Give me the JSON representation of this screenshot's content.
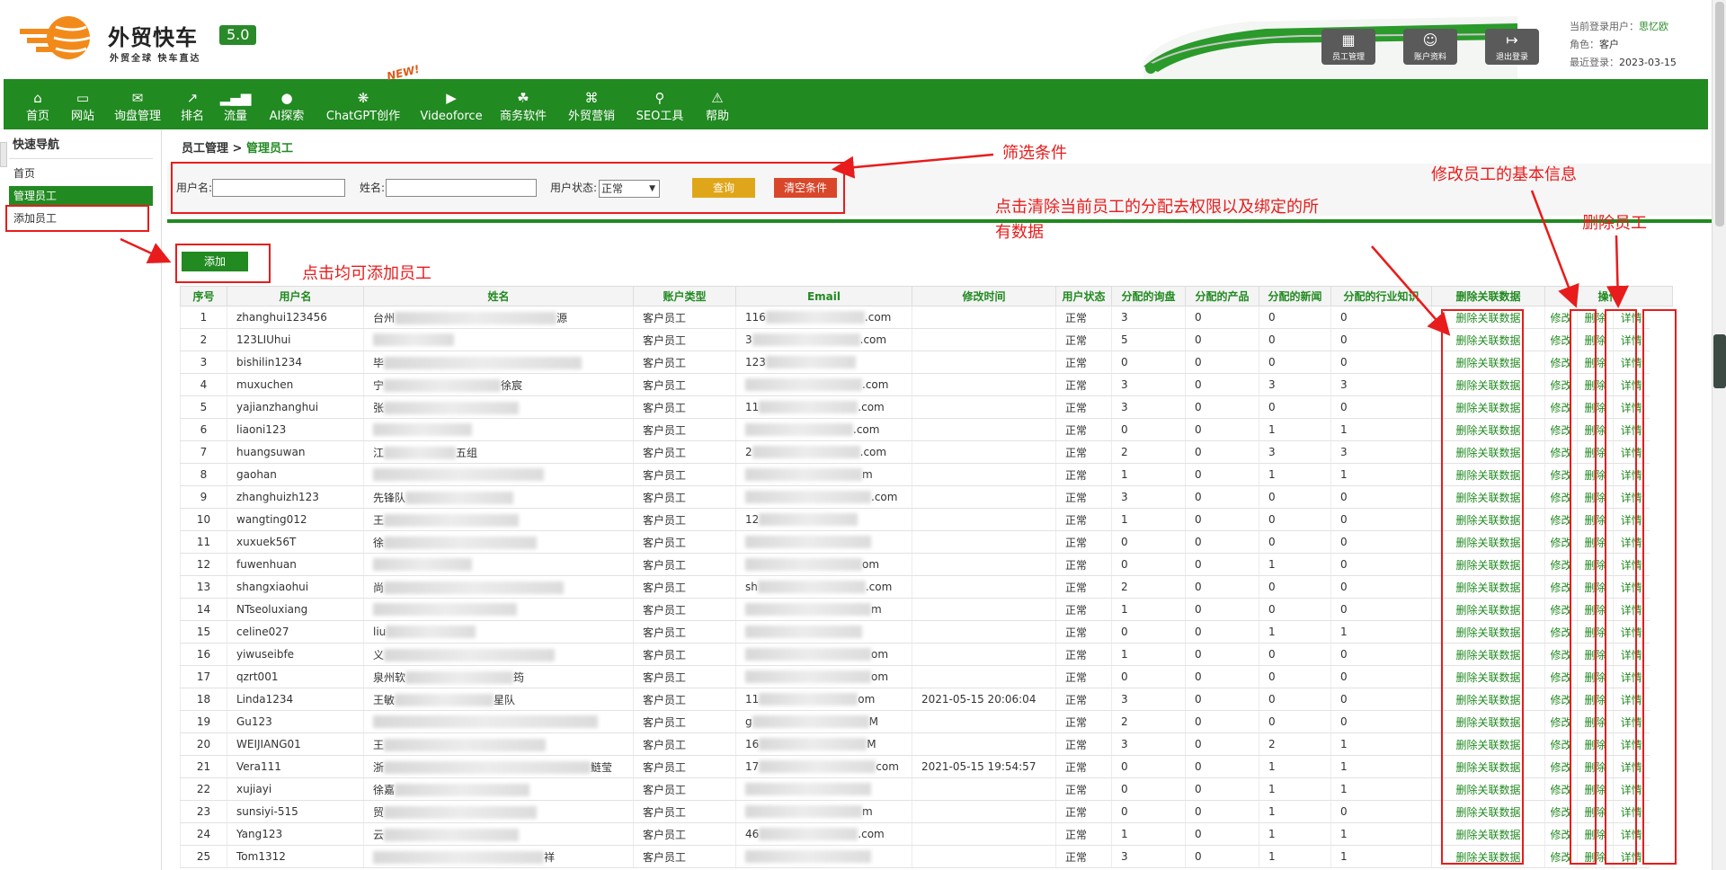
{
  "header": {
    "brand": "外贸快车",
    "version": "5.0",
    "slogan": "外贸全球 快车直达",
    "buttons": [
      {
        "label": "员工管理",
        "icon": "staff-icon"
      },
      {
        "label": "账户资料",
        "icon": "account-icon"
      },
      {
        "label": "退出登录",
        "icon": "logout-icon"
      }
    ],
    "user_label": "当前登录用户：",
    "user": "思忆欧",
    "role_label": "角色：",
    "role": "客户",
    "last_login_label": "最近登录：",
    "last_login": "2023-03-15"
  },
  "nav": {
    "new_badge": "NEW!",
    "items": [
      {
        "label": "首页",
        "icon": "home-icon"
      },
      {
        "label": "网站",
        "icon": "monitor-icon"
      },
      {
        "label": "询盘管理",
        "icon": "mail-icon"
      },
      {
        "label": "排名",
        "icon": "rank-icon"
      },
      {
        "label": "流量",
        "icon": "chart-icon"
      },
      {
        "label": "AI探索",
        "icon": "ai-icon"
      },
      {
        "label": "ChatGPT创作",
        "icon": "chatgpt-icon"
      },
      {
        "label": "Videoforce",
        "icon": "video-icon"
      },
      {
        "label": "商务软件",
        "icon": "software-icon"
      },
      {
        "label": "外贸营销",
        "icon": "marketing-icon"
      },
      {
        "label": "SEO工具",
        "icon": "search-icon"
      },
      {
        "label": "帮助",
        "icon": "help-icon"
      }
    ]
  },
  "sidebar": {
    "title": "快速导航",
    "items": [
      "首页",
      "管理员工",
      "添加员工"
    ]
  },
  "breadcrumb": {
    "parent": "员工管理",
    "sep": " > ",
    "current": "管理员工"
  },
  "filter": {
    "username_label": "用户名:",
    "name_label": "姓名:",
    "status_label": "用户状态:",
    "status_value": "正常",
    "query": "查询",
    "clear": "清空条件"
  },
  "add_button": "添加",
  "table": {
    "headers": [
      "序号",
      "用户名",
      "姓名",
      "账户类型",
      "Email",
      "修改时间",
      "用户状态",
      "分配的询盘",
      "分配的产品",
      "分配的新闻",
      "分配的行业知识",
      "删除关联数据",
      "操作"
    ],
    "actions": {
      "delete_data": "删除关联数据",
      "edit": "修改",
      "delete": "删除",
      "detail": "详情"
    },
    "rows": [
      {
        "no": "1",
        "user": "zhanghui123456",
        "name": "台州",
        "name2": "源",
        "type": "客户员工",
        "email": "116",
        "email2": ".com",
        "time": "",
        "status": "正常",
        "inq": "3",
        "prod": "0",
        "news": "0",
        "know": "0"
      },
      {
        "no": "2",
        "user": "123LIUhui",
        "name": "",
        "name2": "",
        "type": "客户员工",
        "email": "3",
        "email2": ".com",
        "time": "",
        "status": "正常",
        "inq": "5",
        "prod": "0",
        "news": "0",
        "know": "0"
      },
      {
        "no": "3",
        "user": "bishilin1234",
        "name": "毕",
        "name2": "",
        "type": "客户员工",
        "email": "123",
        "email2": "",
        "time": "",
        "status": "正常",
        "inq": "0",
        "prod": "0",
        "news": "0",
        "know": "0"
      },
      {
        "no": "4",
        "user": "muxuchen",
        "name": "宁",
        "name2": "徐宸",
        "type": "客户员工",
        "email": "",
        "email2": ".com",
        "time": "",
        "status": "正常",
        "inq": "3",
        "prod": "0",
        "news": "3",
        "know": "3"
      },
      {
        "no": "5",
        "user": "yajianzhanghui",
        "name": "张",
        "name2": "",
        "type": "客户员工",
        "email": "11",
        "email2": ".com",
        "time": "",
        "status": "正常",
        "inq": "3",
        "prod": "0",
        "news": "0",
        "know": "0"
      },
      {
        "no": "6",
        "user": "liaoni123",
        "name": "",
        "name2": "",
        "type": "客户员工",
        "email": "",
        "email2": ".com",
        "time": "",
        "status": "正常",
        "inq": "0",
        "prod": "0",
        "news": "1",
        "know": "1"
      },
      {
        "no": "7",
        "user": "huangsuwan",
        "name": "江",
        "name2": "五组",
        "type": "客户员工",
        "email": "2",
        "email2": ".com",
        "time": "",
        "status": "正常",
        "inq": "2",
        "prod": "0",
        "news": "3",
        "know": "3"
      },
      {
        "no": "8",
        "user": "gaohan",
        "name": "",
        "name2": "",
        "type": "客户员工",
        "email": "",
        "email2": "m",
        "time": "",
        "status": "正常",
        "inq": "1",
        "prod": "0",
        "news": "1",
        "know": "1"
      },
      {
        "no": "9",
        "user": "zhanghuizh123",
        "name": "先锋队",
        "name2": "",
        "type": "客户员工",
        "email": "",
        "email2": ".com",
        "time": "",
        "status": "正常",
        "inq": "3",
        "prod": "0",
        "news": "0",
        "know": "0"
      },
      {
        "no": "10",
        "user": "wangting012",
        "name": "王",
        "name2": "",
        "type": "客户员工",
        "email": "12",
        "email2": "",
        "time": "",
        "status": "正常",
        "inq": "1",
        "prod": "0",
        "news": "0",
        "know": "0"
      },
      {
        "no": "11",
        "user": "xuxuek56T",
        "name": "徐",
        "name2": "",
        "type": "客户员工",
        "email": "",
        "email2": "",
        "time": "",
        "status": "正常",
        "inq": "0",
        "prod": "0",
        "news": "0",
        "know": "0"
      },
      {
        "no": "12",
        "user": "fuwenhuan",
        "name": "",
        "name2": "",
        "type": "客户员工",
        "email": "",
        "email2": "om",
        "time": "",
        "status": "正常",
        "inq": "0",
        "prod": "0",
        "news": "1",
        "know": "0"
      },
      {
        "no": "13",
        "user": "shangxiaohui",
        "name": "尚",
        "name2": "",
        "type": "客户员工",
        "email": "sh",
        "email2": ".com",
        "time": "",
        "status": "正常",
        "inq": "2",
        "prod": "0",
        "news": "0",
        "know": "0"
      },
      {
        "no": "14",
        "user": "NTseoluxiang",
        "name": "",
        "name2": "",
        "type": "客户员工",
        "email": "",
        "email2": "m",
        "time": "",
        "status": "正常",
        "inq": "1",
        "prod": "0",
        "news": "0",
        "know": "0"
      },
      {
        "no": "15",
        "user": "celine027",
        "name": "liu",
        "name2": "",
        "type": "客户员工",
        "email": "",
        "email2": "",
        "time": "",
        "status": "正常",
        "inq": "0",
        "prod": "0",
        "news": "1",
        "know": "1"
      },
      {
        "no": "16",
        "user": "yiwuseibfe",
        "name": "义",
        "name2": "",
        "type": "客户员工",
        "email": "",
        "email2": "om",
        "time": "",
        "status": "正常",
        "inq": "1",
        "prod": "0",
        "news": "0",
        "know": "0"
      },
      {
        "no": "17",
        "user": "qzrt001",
        "name": "泉州软",
        "name2": "筠",
        "type": "客户员工",
        "email": "",
        "email2": "om",
        "time": "",
        "status": "正常",
        "inq": "0",
        "prod": "0",
        "news": "0",
        "know": "0"
      },
      {
        "no": "18",
        "user": "Linda1234",
        "name": "王敏",
        "name2": "星队",
        "type": "客户员工",
        "email": "11",
        "email2": "om",
        "time": "2021-05-15 20:06:04",
        "status": "正常",
        "inq": "3",
        "prod": "0",
        "news": "0",
        "know": "0"
      },
      {
        "no": "19",
        "user": "Gu123",
        "name": "",
        "name2": "",
        "type": "客户员工",
        "email": "g",
        "email2": "M",
        "time": "",
        "status": "正常",
        "inq": "2",
        "prod": "0",
        "news": "0",
        "know": "0"
      },
      {
        "no": "20",
        "user": "WEIJIANG01",
        "name": "王",
        "name2": "",
        "type": "客户员工",
        "email": "16",
        "email2": "M",
        "time": "",
        "status": "正常",
        "inq": "3",
        "prod": "0",
        "news": "2",
        "know": "1"
      },
      {
        "no": "21",
        "user": "Vera111",
        "name": "浙",
        "name2": "鲢莹",
        "type": "客户员工",
        "email": "17",
        "email2": "com",
        "time": "2021-05-15 19:54:57",
        "status": "正常",
        "inq": "0",
        "prod": "0",
        "news": "1",
        "know": "1"
      },
      {
        "no": "22",
        "user": "xujiayi",
        "name": "徐嘉",
        "name2": "",
        "type": "客户员工",
        "email": "",
        "email2": "",
        "time": "",
        "status": "正常",
        "inq": "0",
        "prod": "0",
        "news": "1",
        "know": "1"
      },
      {
        "no": "23",
        "user": "sunsiyi-515",
        "name": "贸",
        "name2": "",
        "type": "客户员工",
        "email": "",
        "email2": "m",
        "time": "",
        "status": "正常",
        "inq": "0",
        "prod": "0",
        "news": "1",
        "know": "0"
      },
      {
        "no": "24",
        "user": "Yang123",
        "name": "云",
        "name2": "",
        "type": "客户员工",
        "email": "46",
        "email2": ".com",
        "time": "",
        "status": "正常",
        "inq": "1",
        "prod": "0",
        "news": "1",
        "know": "1"
      },
      {
        "no": "25",
        "user": "Tom1312",
        "name": "",
        "name2": "祥",
        "type": "客户员工",
        "email": "",
        "email2": "",
        "time": "",
        "status": "正常",
        "inq": "3",
        "prod": "0",
        "news": "1",
        "know": "1"
      }
    ]
  },
  "annotations": {
    "filter_note": "筛选条件",
    "add_note": "点击均可添加员工",
    "clear_note_1": "点击清除当前员工的分配去权限以及绑定的所",
    "clear_note_2": "有数据",
    "edit_note": "修改员工的基本信息",
    "delete_note": "删除员工"
  },
  "colors": {
    "brand_green": "#218a21",
    "annotation_red": "#e81c1c",
    "query_yellow": "#e0a61a",
    "clear_red": "#d9472b"
  }
}
